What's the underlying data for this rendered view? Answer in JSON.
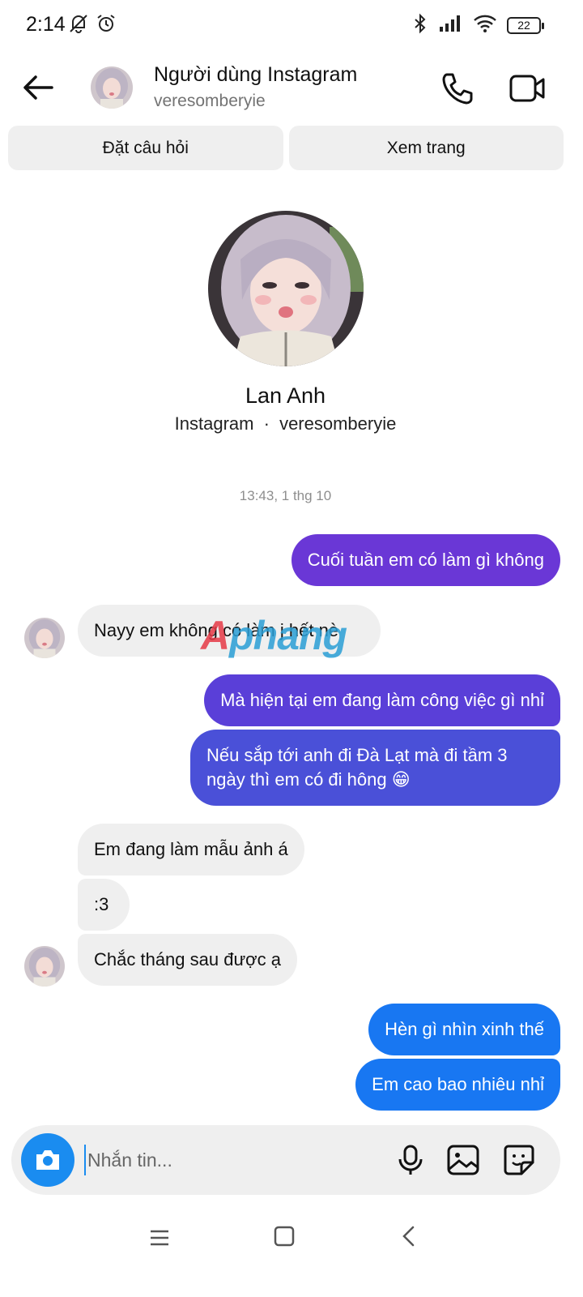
{
  "status_bar": {
    "time": "2:14",
    "battery": "22"
  },
  "header": {
    "title": "Người dùng Instagram",
    "subtitle": "veresomberyie"
  },
  "actions": {
    "ask_label": "Đặt câu hỏi",
    "view_label": "Xem trang"
  },
  "profile": {
    "name": "Lan Anh",
    "platform": "Instagram",
    "separator": "·",
    "handle": "veresomberyie"
  },
  "timestamp": "13:43, 1 thg 10",
  "watermark": {
    "part_a": "A",
    "part_b": "phang"
  },
  "messages": [
    {
      "from": "me",
      "text": "Cuối tuần em có làm gì không"
    },
    {
      "from": "them",
      "text": "Nayy em không có làm j hết nè"
    },
    {
      "from": "me",
      "text": "Mà hiện tại em đang làm công việc gì nhỉ"
    },
    {
      "from": "me",
      "text": "Nếu sắp tới anh đi Đà Lạt mà đi tầm 3 ngày thì em có đi hông 😁"
    },
    {
      "from": "them",
      "text": "Em đang làm mẫu ảnh á"
    },
    {
      "from": "them",
      "text": ":3"
    },
    {
      "from": "them",
      "text": "Chắc tháng sau được ạ"
    },
    {
      "from": "me",
      "text": "Hèn gì nhìn xinh thế"
    },
    {
      "from": "me",
      "text": "Em cao bao nhiêu nhỉ"
    }
  ],
  "composer": {
    "placeholder": "Nhắn tin..."
  },
  "colors": {
    "purple": "#6c3bd9",
    "indigo": "#4b4fd6",
    "blue": "#1877f2",
    "bubble_in": "#efefef"
  }
}
